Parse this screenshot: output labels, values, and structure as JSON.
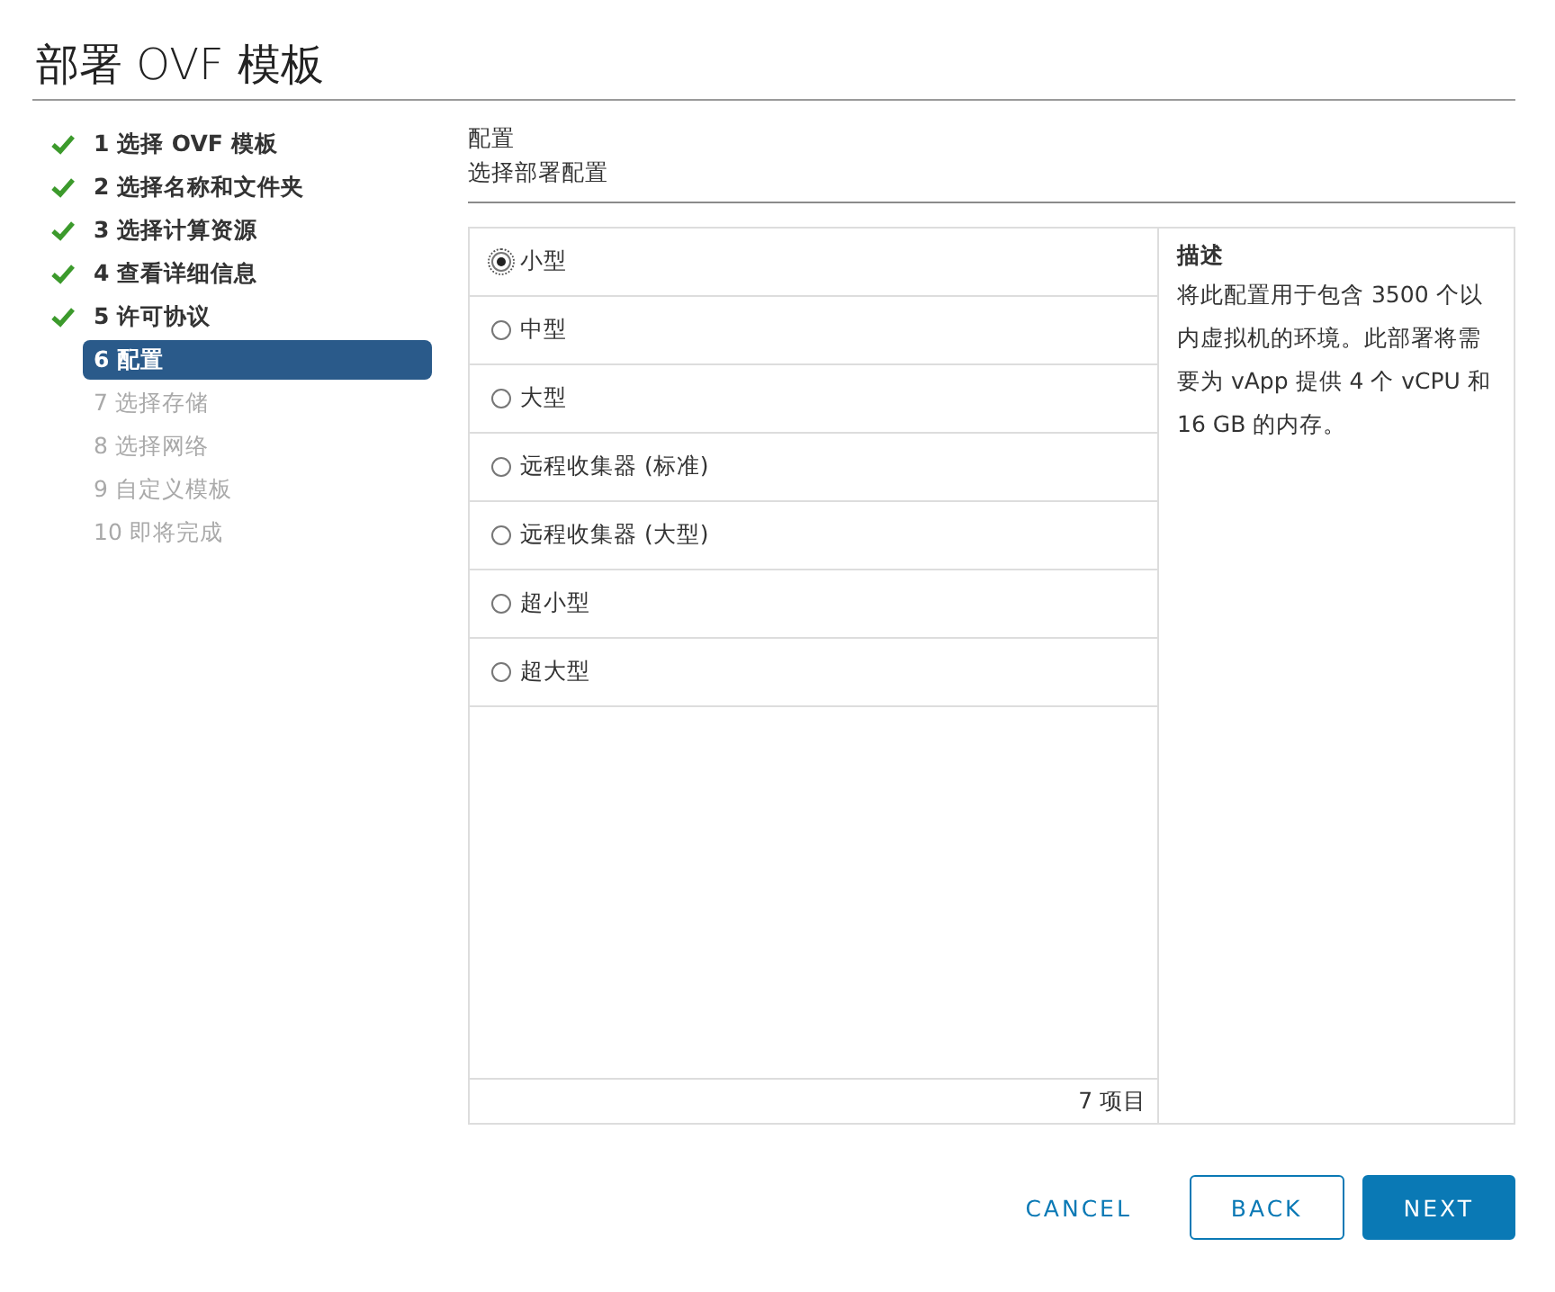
{
  "window": {
    "title": "部署 OVF 模板"
  },
  "steps": [
    {
      "label": "1 选择 OVF 模板",
      "completed": true,
      "selected": false
    },
    {
      "label": "2 选择名称和文件夹",
      "completed": true,
      "selected": false
    },
    {
      "label": "3 选择计算资源",
      "completed": true,
      "selected": false
    },
    {
      "label": "4 查看详细信息",
      "completed": true,
      "selected": false
    },
    {
      "label": "5 许可协议",
      "completed": true,
      "selected": false
    },
    {
      "label": "6 配置",
      "completed": false,
      "selected": true
    },
    {
      "label": "7 选择存储",
      "completed": false,
      "selected": false
    },
    {
      "label": "8 选择网络",
      "completed": false,
      "selected": false
    },
    {
      "label": "9 自定义模板",
      "completed": false,
      "selected": false
    },
    {
      "label": "10 即将完成",
      "completed": false,
      "selected": false
    }
  ],
  "page": {
    "title": "配置",
    "subtitle": "选择部署配置"
  },
  "options": [
    {
      "label": "小型",
      "selected": true
    },
    {
      "label": "中型",
      "selected": false
    },
    {
      "label": "大型",
      "selected": false
    },
    {
      "label": "远程收集器 (标准)",
      "selected": false
    },
    {
      "label": "远程收集器 (大型)",
      "selected": false
    },
    {
      "label": "超小型",
      "selected": false
    },
    {
      "label": "超大型",
      "selected": false
    }
  ],
  "footer": "7 项目",
  "description": {
    "title": "描述",
    "text": "将此配置用于包含 3500 个以内虚拟机的环境。此部署将需要为 vApp 提供 4 个 vCPU 和 16 GB 的内存。"
  },
  "buttons": [
    {
      "label": "CANCEL",
      "kind": "link"
    },
    {
      "label": "BACK",
      "kind": "outline"
    },
    {
      "label": "NEXT",
      "kind": "primary"
    }
  ]
}
